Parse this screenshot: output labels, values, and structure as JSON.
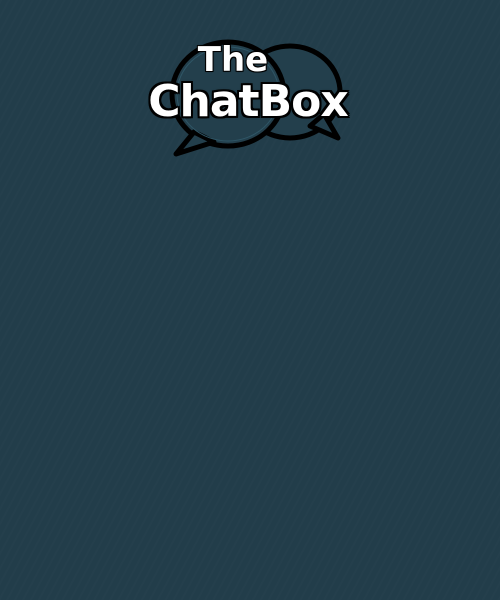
{
  "app": {
    "logo": {
      "line1": "The",
      "line2": "ChatBox",
      "icon": "speech-bubbles-icon"
    }
  },
  "colors": {
    "background": "#223d4a",
    "bubble_fill": "#233f4c",
    "bubble_outline": "#000000",
    "logo_text": "#ffffff"
  }
}
